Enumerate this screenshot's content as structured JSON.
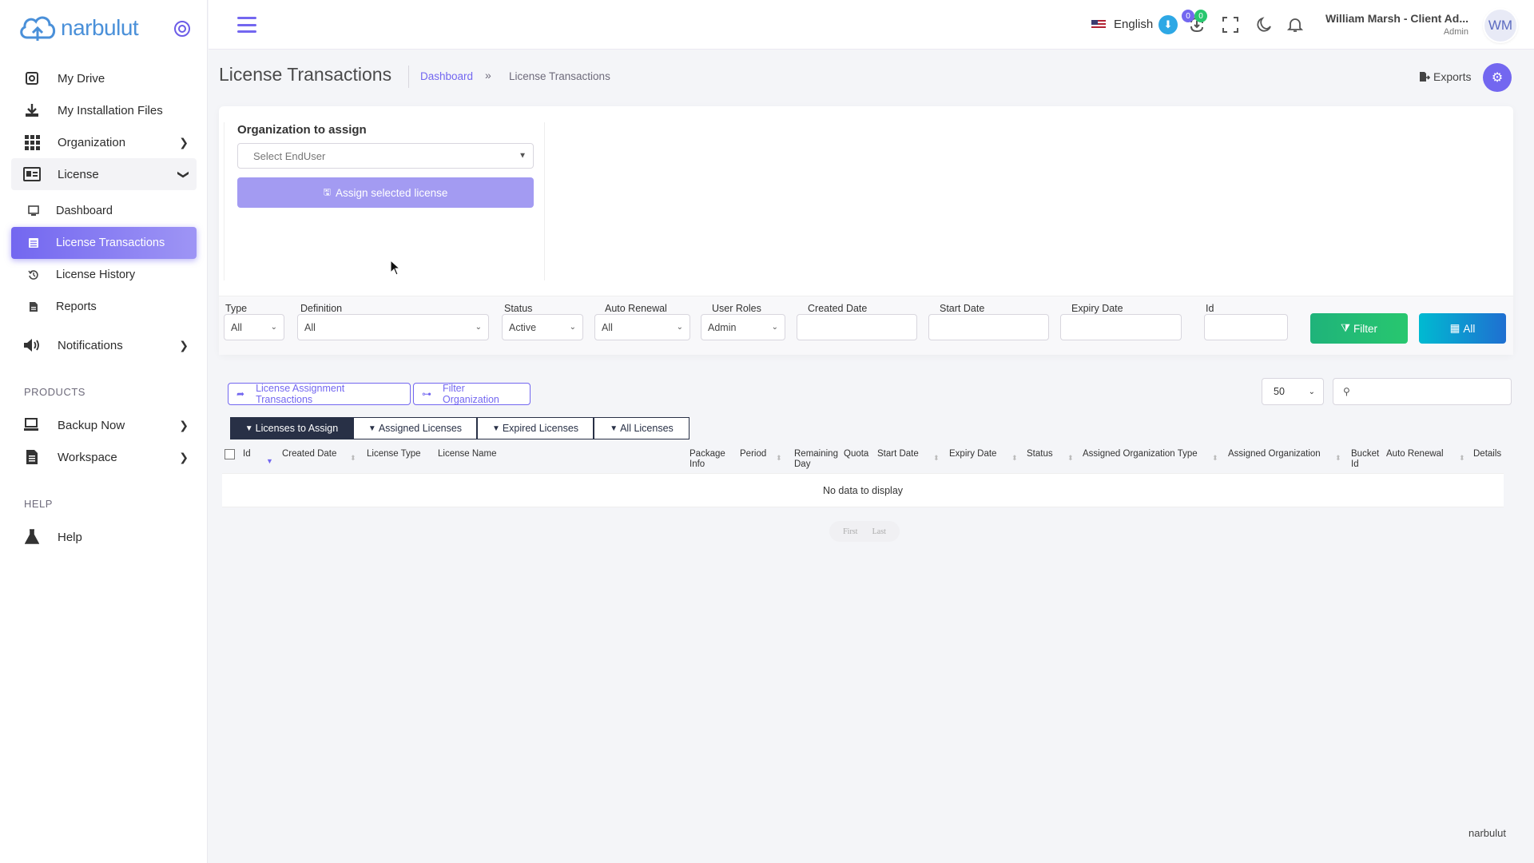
{
  "app": {
    "brand": "narbulut"
  },
  "sidebar": {
    "items": [
      {
        "label": "My Drive",
        "icon": "drive-icon"
      },
      {
        "label": "My Installation Files",
        "icon": "download-icon"
      },
      {
        "label": "Organization",
        "icon": "grid-icon"
      },
      {
        "label": "License",
        "icon": "id-card-icon"
      },
      {
        "label": "Dashboard",
        "icon": "monitor-icon"
      },
      {
        "label": "License Transactions",
        "icon": "list-icon"
      },
      {
        "label": "License History",
        "icon": "history-icon"
      },
      {
        "label": "Reports",
        "icon": "file-icon"
      },
      {
        "label": "Notifications",
        "icon": "speaker-icon"
      }
    ],
    "sections": {
      "products": "PRODUCTS",
      "help": "HELP"
    },
    "products": [
      {
        "label": "Backup Now",
        "icon": "computer-icon"
      },
      {
        "label": "Workspace",
        "icon": "document-icon"
      }
    ],
    "help": [
      {
        "label": "Help",
        "icon": "flask-icon"
      }
    ]
  },
  "topbar": {
    "language": "English",
    "badge_blue": "0",
    "badge_green": "0",
    "user_name": "William Marsh - Client Ad...",
    "user_role": "Admin",
    "avatar_initials": "WM"
  },
  "header": {
    "title": "License Transactions",
    "breadcrumb_home": "Dashboard",
    "breadcrumb_sep": "»",
    "breadcrumb_current": "License Transactions",
    "exports": "Exports"
  },
  "assign": {
    "label": "Organization to assign",
    "placeholder": "Select EndUser",
    "button": "Assign selected license"
  },
  "filters": {
    "type": {
      "label": "Type",
      "value": "All"
    },
    "definition": {
      "label": "Definition",
      "value": "All"
    },
    "status": {
      "label": "Status",
      "value": "Active"
    },
    "auto_renewal": {
      "label": "Auto Renewal",
      "value": "All"
    },
    "user_roles": {
      "label": "User Roles",
      "value": "Admin"
    },
    "created_date": {
      "label": "Created Date"
    },
    "start_date": {
      "label": "Start Date"
    },
    "expiry_date": {
      "label": "Expiry Date"
    },
    "id": {
      "label": "Id"
    },
    "filter_button": "Filter",
    "all_button": "All"
  },
  "toolbar": {
    "assignment_tx": "License Assignment Transactions",
    "filter_org": "Filter Organization",
    "per_page": "50"
  },
  "tabs": [
    {
      "label": "Licenses to Assign",
      "active": true
    },
    {
      "label": "Assigned Licenses",
      "active": false
    },
    {
      "label": "Expired Licenses",
      "active": false
    },
    {
      "label": "All Licenses",
      "active": false
    }
  ],
  "table": {
    "columns": [
      "Id",
      "Created Date",
      "License Type",
      "License Name",
      "Package Info",
      "Period",
      "Remaining Day",
      "Quota",
      "Start Date",
      "Expiry Date",
      "Status",
      "Assigned Organization Type",
      "Assigned Organization",
      "Bucket Id",
      "Auto Renewal",
      "Details"
    ],
    "empty": "No data to display",
    "pager_first": "First",
    "pager_last": "Last"
  },
  "footer": {
    "brand": "narbulut"
  },
  "colors": {
    "primary": "#7367f0",
    "filter_green": "#28c76f",
    "all_blue": "#00bad1",
    "dark_tab": "#283046"
  }
}
